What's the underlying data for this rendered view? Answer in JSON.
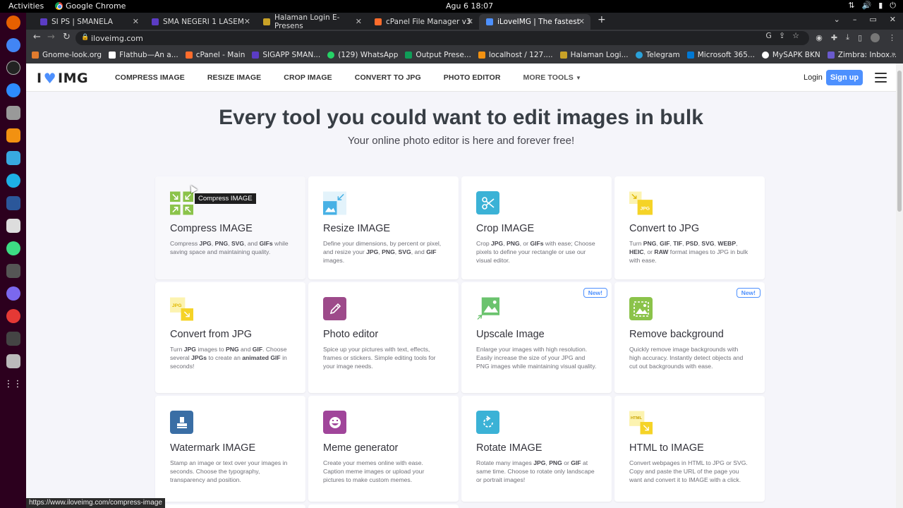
{
  "system": {
    "activities": "Activities",
    "app_name": "Google Chrome",
    "clock": "Agu 6  18:07"
  },
  "tabs": [
    {
      "label": "SI PS | SMANELA",
      "color": "#5b3cc4"
    },
    {
      "label": "SMA NEGERI 1 LASEM",
      "color": "#5b3cc4"
    },
    {
      "label": "Halaman Login E-Presens",
      "color": "#c9a227"
    },
    {
      "label": "cPanel File Manager v3",
      "color": "#ff6c2c"
    },
    {
      "label": "iLoveIMG | The fastest fre",
      "color": "#4d90fe"
    }
  ],
  "address": {
    "url": "iloveimg.com"
  },
  "bookmarks": [
    {
      "label": "Gnome-look.org",
      "color": "#e07b2e"
    },
    {
      "label": "Flathub—An a...",
      "color": "#ffffff"
    },
    {
      "label": "cPanel - Main",
      "color": "#ff6c2c"
    },
    {
      "label": "SIGAPP SMAN...",
      "color": "#5b3cc4"
    },
    {
      "label": "(129) WhatsApp",
      "color": "#25d366"
    },
    {
      "label": "Output Prese...",
      "color": "#0f9d58"
    },
    {
      "label": "localhost / 127....",
      "color": "#f29111"
    },
    {
      "label": "Halaman Logi...",
      "color": "#c9a227"
    },
    {
      "label": "Telegram",
      "color": "#2aa1da"
    },
    {
      "label": "Microsoft 365...",
      "color": "#0078d4"
    },
    {
      "label": "MySAPK BKN",
      "color": "#ffffff"
    },
    {
      "label": "Zimbra: Inbox...",
      "color": "#6a5acd"
    }
  ],
  "header": {
    "logo_left": "I",
    "logo_right": "IMG",
    "nav": [
      "COMPRESS IMAGE",
      "RESIZE IMAGE",
      "CROP IMAGE",
      "CONVERT TO JPG",
      "PHOTO EDITOR"
    ],
    "more_tools": "MORE TOOLS",
    "login": "Login",
    "signup": "Sign up"
  },
  "hero": {
    "title": "Every tool you could want to edit images in bulk",
    "subtitle": "Your online photo editor is here and forever free!"
  },
  "tools": [
    {
      "name": "Compress IMAGE",
      "desc": "Compress JPG, PNG, SVG, and GIFs while saving space and maintaining quality.",
      "icon": "compress-icon",
      "color": "#8bc34a"
    },
    {
      "name": "Resize IMAGE",
      "desc": "Define your dimensions, by percent or pixel, and resize your JPG, PNG, SVG, and GIF images.",
      "icon": "resize-icon",
      "color": "#48b1e5"
    },
    {
      "name": "Crop IMAGE",
      "desc": "Crop JPG, PNG, or GIFs with ease; Choose pixels to define your rectangle or use our visual editor.",
      "icon": "scissors-icon",
      "color": "#3bb2d6"
    },
    {
      "name": "Convert to JPG",
      "desc": "Turn PNG, GIF, TIF, PSD, SVG, WEBP, HEIC, or RAW format images to JPG in bulk with ease.",
      "icon": "jpg-icon",
      "color": "#f5d327"
    },
    {
      "name": "Convert from JPG",
      "desc": "Turn JPG images to PNG and GIF. Choose several JPGs to create an animated GIF in seconds!",
      "icon": "jpg-out-icon",
      "color": "#f5d327"
    },
    {
      "name": "Photo editor",
      "desc": "Spice up your pictures with text, effects, frames or stickers. Simple editing tools for your image needs.",
      "icon": "pencil-icon",
      "color": "#9d4a8a"
    },
    {
      "name": "Upscale Image",
      "desc": "Enlarge your images with high resolution. Easily increase the size of your JPG and PNG images while maintaining visual quality.",
      "icon": "upscale-icon",
      "color": "#6bc36e",
      "badge": "New!"
    },
    {
      "name": "Remove background",
      "desc": "Quickly remove image backgrounds with high accuracy. Instantly detect objects and cut out backgrounds with ease.",
      "icon": "remove-bg-icon",
      "color": "#8bc34a",
      "badge": "New!"
    },
    {
      "name": "Watermark IMAGE",
      "desc": "Stamp an image or text over your images in seconds. Choose the typography, transparency and position.",
      "icon": "stamp-icon",
      "color": "#3a6ea5"
    },
    {
      "name": "Meme generator",
      "desc": "Create your memes online with ease. Caption meme images or upload your pictures to make custom memes.",
      "icon": "meme-icon",
      "color": "#a0459a"
    },
    {
      "name": "Rotate IMAGE",
      "desc": "Rotate many images JPG, PNG or GIF at same time. Choose to rotate only landscape or portrait images!",
      "icon": "rotate-icon",
      "color": "#3bb2d6"
    },
    {
      "name": "HTML to IMAGE",
      "desc": "Convert webpages in HTML to JPG or SVG. Copy and paste the URL of the page you want and convert it to IMAGE with a click.",
      "icon": "html-icon",
      "color": "#f5d327"
    }
  ],
  "tooltip": "Compress IMAGE",
  "status_url": "https://www.iloveimg.com/compress-image"
}
